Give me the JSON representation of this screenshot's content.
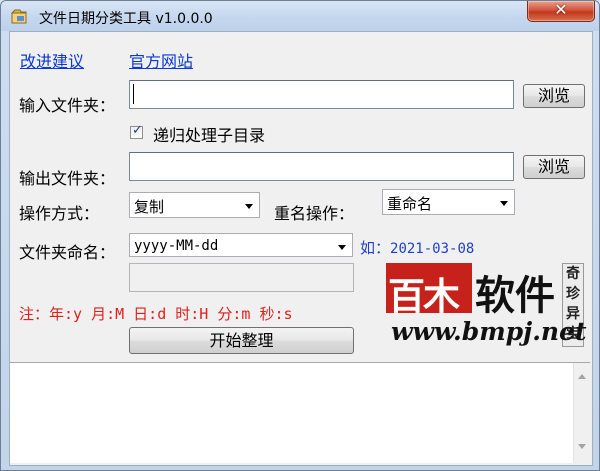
{
  "window": {
    "title": "文件日期分类工具 v1.0.0.0",
    "close_glyph": "✕"
  },
  "links": {
    "suggest": "改进建议",
    "website": "官方网站"
  },
  "input_folder": {
    "label": "输入文件夹：",
    "value": "",
    "browse_label": "浏览"
  },
  "recursive": {
    "label": "递归处理子目录",
    "checked": true
  },
  "output_folder": {
    "label": "输出文件夹：",
    "value": "",
    "browse_label": "浏览"
  },
  "operation": {
    "label": "操作方式：",
    "selected": "复制"
  },
  "rename": {
    "label": "重名操作：",
    "selected": "重命名"
  },
  "folder_naming": {
    "label": "文件夹命名：",
    "selected": "yyyy-MM-dd",
    "example_prefix": "如：",
    "example_value": "2021-03-08"
  },
  "note": "注：年:y 月:M 日:d 时:H 分:m 秒:s",
  "start_button": "开始整理",
  "logo": {
    "name": "百木",
    "soft": "软件",
    "side": [
      "奇",
      "珍",
      "异",
      "宝"
    ],
    "url": "www.bmpj.net"
  },
  "icons": {
    "app": "app-icon",
    "close": "close-icon",
    "check": "check-icon",
    "dropdown": "chevron-down-icon",
    "scroll_up": "scroll-up-icon",
    "scroll_down": "scroll-down-icon"
  }
}
